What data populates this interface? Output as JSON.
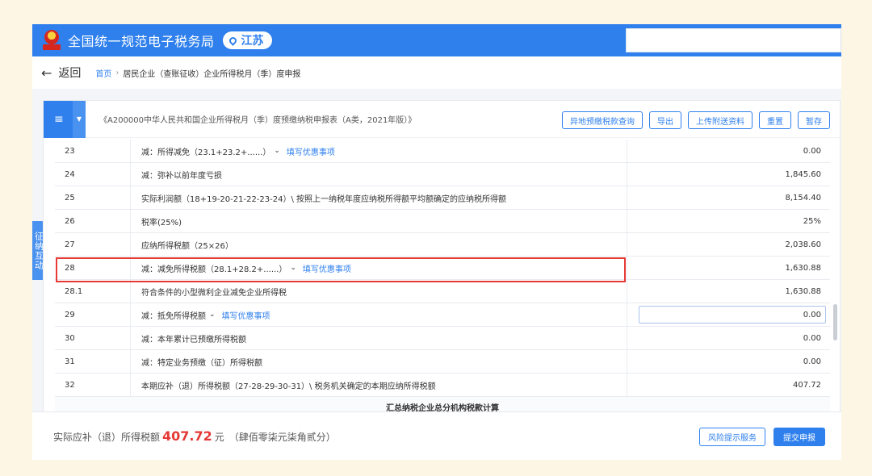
{
  "header": {
    "site_title": "全国统一规范电子税务局",
    "region": "江苏",
    "search_value": ""
  },
  "breadcrumb": {
    "back_label": "返回",
    "home": "首页",
    "separator": "›",
    "current": "居民企业（查账征收）企业所得税月（季）度申报"
  },
  "toolbar": {
    "menu_icon": "≡",
    "form_title": "《A200000中华人民共和国企业所得税月（季）度预缴纳税申报表（A类，2021年版）》",
    "buttons": {
      "remote_query": "异地预缴税款查询",
      "export": "导出",
      "upload": "上传附送资料",
      "reset": "重置",
      "save_draft": "暂存"
    }
  },
  "side_tab": "征纳互动",
  "rows": [
    {
      "no": "23",
      "item": "减：所得减免（23.1+23.2+......）",
      "link": "填写优惠事项",
      "value": "0.00"
    },
    {
      "no": "24",
      "item": "减：弥补以前年度亏损",
      "value": "1,845.60"
    },
    {
      "no": "25",
      "item": "实际利润额（18+19-20-21-22-23-24）\\ 按照上一纳税年度应纳税所得额平均额确定的应纳税所得额",
      "value": "8,154.40"
    },
    {
      "no": "26",
      "item": "税率(25%)",
      "value": "25%"
    },
    {
      "no": "27",
      "item": "应纳所得税额（25×26）",
      "value": "2,038.60"
    },
    {
      "no": "28",
      "item": "减：减免所得税额（28.1+28.2+......）",
      "link": "填写优惠事项",
      "value": "1,630.88"
    },
    {
      "no": "28.1",
      "item": "符合条件的小型微利企业减免企业所得税",
      "value": "1,630.88"
    },
    {
      "no": "29",
      "item": "减：抵免所得税额",
      "link": "填写优惠事项",
      "value": "0.00"
    },
    {
      "no": "30",
      "item": "减：本年累计已预缴所得税额",
      "value": "0.00"
    },
    {
      "no": "31",
      "item": "减：特定业务预缴（征）所得税额",
      "value": "0.00"
    },
    {
      "no": "32",
      "item": "本期应补（退）所得税额（27-28-29-30-31）\\ 税务机关确定的本期应纳所得税额",
      "value": "407.72"
    }
  ],
  "group_heading": "汇总纳税企业总分机构税款计算",
  "footer": {
    "tax_label": "实际应补（退）所得税额",
    "tax_amount": "407.72",
    "tax_unit": "元",
    "tax_in_words": "（肆佰零柒元柒角贰分）",
    "risk_button": "风险提示服务",
    "submit_button": "提交申报"
  },
  "colors": {
    "primary": "#2f80ed",
    "highlight_border": "#e53935",
    "amount": "#e53935",
    "background": "#fdf6e4"
  }
}
